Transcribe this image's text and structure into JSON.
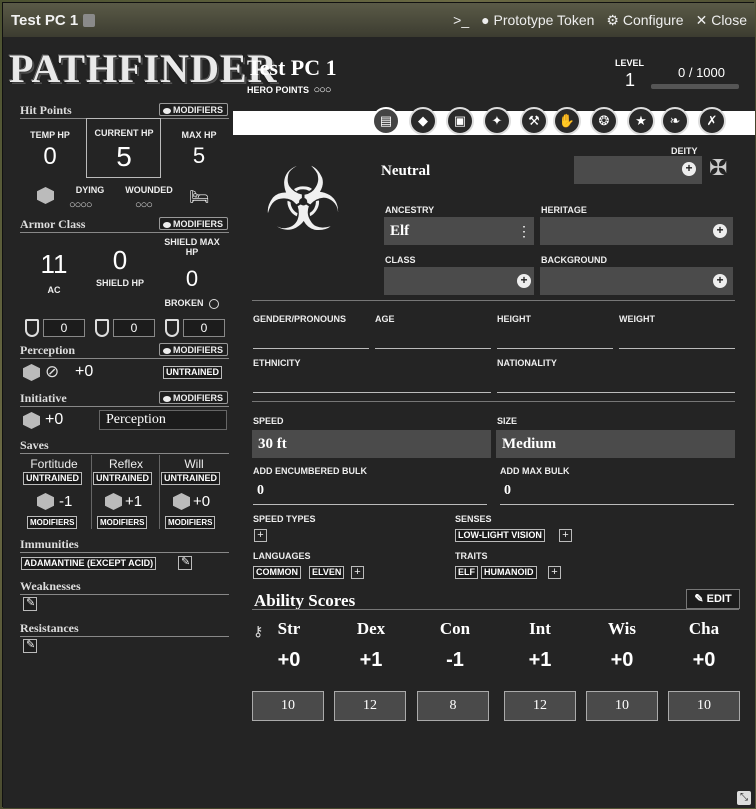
{
  "window": {
    "title": "Test PC 1",
    "header_buttons": [
      {
        "icon": "terminal-icon",
        "label": ""
      },
      {
        "icon": "user-circle-icon",
        "label": "Prototype Token"
      },
      {
        "icon": "user-gear-icon",
        "label": "Configure"
      },
      {
        "icon": "close-icon",
        "label": "Close"
      }
    ]
  },
  "logo_text": "PATHFINDER",
  "left": {
    "hit_points": {
      "title": "Hit Points",
      "modifiers": "MODIFIERS",
      "temp_label": "TEMP HP",
      "temp_value": "0",
      "current_label": "CURRENT HP",
      "current_value": "5",
      "max_label": "MAX HP",
      "max_value": "5",
      "dying_label": "DYING",
      "dying_pips": "○○○○",
      "wounded_label": "WOUNDED",
      "wounded_pips": "○○○"
    },
    "armor_class": {
      "title": "Armor Class",
      "modifiers": "MODIFIERS",
      "ac_value": "11",
      "ac_label": "AC",
      "shield_hp_value": "0",
      "shield_hp_label": "SHIELD HP",
      "shield_max_label": "SHIELD MAX HP",
      "shield_max_value": "0",
      "broken_label": "BROKEN",
      "shield_fields": [
        "0",
        "0",
        "0"
      ]
    },
    "perception": {
      "title": "Perception",
      "modifiers": "MODIFIERS",
      "value": "+0",
      "rank": "UNTRAINED"
    },
    "initiative": {
      "title": "Initiative",
      "modifiers": "MODIFIERS",
      "value": "+0",
      "skill": "Perception"
    },
    "saves": {
      "title": "Saves",
      "items": [
        {
          "name": "Fortitude",
          "rank": "UNTRAINED",
          "value": "-1",
          "modifiers": "MODIFIERS"
        },
        {
          "name": "Reflex",
          "rank": "UNTRAINED",
          "value": "+1",
          "modifiers": "MODIFIERS"
        },
        {
          "name": "Will",
          "rank": "UNTRAINED",
          "value": "+0",
          "modifiers": "MODIFIERS"
        }
      ]
    },
    "immunities": {
      "title": "Immunities",
      "tag": "ADAMANTINE (EXCEPT ACID)"
    },
    "weaknesses": {
      "title": "Weaknesses"
    },
    "resistances": {
      "title": "Resistances"
    }
  },
  "right": {
    "name": "Test PC 1",
    "hero_points_label": "HERO POINTS",
    "hero_points_pips": "○○○",
    "level_label": "LEVEL",
    "level_value": "1",
    "xp_text": "0 /  1000",
    "nav_icons": [
      "id-card-icon",
      "arrow-right-icon",
      "chest-icon",
      "wand-icon",
      "hammer-icon",
      "hand-icon",
      "medal-icon",
      "star-icon",
      "book-reader-icon",
      "crossed-swords-icon"
    ],
    "alignment": "Neutral",
    "deity_label": "DEITY",
    "ancestry_label": "ANCESTRY",
    "ancestry_value": "Elf",
    "heritage_label": "HERITAGE",
    "class_label": "CLASS",
    "background_label": "BACKGROUND",
    "gender_label": "GENDER/PRONOUNS",
    "age_label": "AGE",
    "height_label": "HEIGHT",
    "weight_label": "WEIGHT",
    "ethnicity_label": "ETHNICITY",
    "nationality_label": "NATIONALITY",
    "speed_label": "SPEED",
    "speed_value": "30 ft",
    "size_label": "SIZE",
    "size_value": "Medium",
    "encumbered_label": "ADD ENCUMBERED BULK",
    "encumbered_value": "0",
    "maxbulk_label": "ADD MAX BULK",
    "maxbulk_value": "0",
    "speed_types_label": "SPEED TYPES",
    "senses_label": "SENSES",
    "senses_tag": "LOW-LIGHT VISION",
    "languages_label": "LANGUAGES",
    "languages": [
      "COMMON",
      "ELVEN"
    ],
    "traits_label": "TRAITS",
    "traits": [
      "ELF",
      "HUMANOID"
    ],
    "ability_title": "Ability Scores",
    "edit_label": "EDIT",
    "abilities": [
      {
        "name": "Str",
        "mod": "+0",
        "score": "10"
      },
      {
        "name": "Dex",
        "mod": "+1",
        "score": "12"
      },
      {
        "name": "Con",
        "mod": "-1",
        "score": "8"
      },
      {
        "name": "Int",
        "mod": "+1",
        "score": "12"
      },
      {
        "name": "Wis",
        "mod": "+0",
        "score": "10"
      },
      {
        "name": "Cha",
        "mod": "+0",
        "score": "10"
      }
    ]
  }
}
